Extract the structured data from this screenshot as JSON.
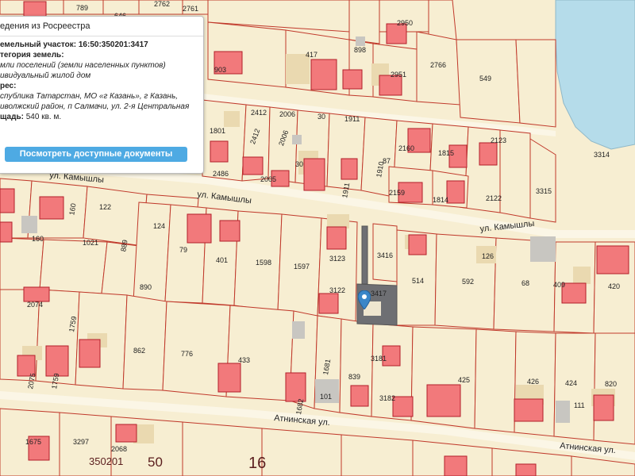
{
  "info_panel": {
    "title": "едения из Росреестра",
    "cadastral_label": "емельный участок:",
    "cadastral_number": "16:50:350201:3417",
    "category_label": "тегория земель:",
    "category_value": "мли поселений (земли населенных пунктов)",
    "usage_value": "ивидуальный жилой дом",
    "address_label": "рес:",
    "address_line1": "спублика Татарстан, МО «г Казань», г Казань,",
    "address_line2": "иволжский район, п Салмачи, ул. 2-я Центральная",
    "area_label": "щадь:",
    "area_value": "540 кв. м.",
    "docs_button": "Посмотреть доступные документы"
  },
  "streets": [
    "ул. Камышлы",
    "ул. Камышлы",
    "ул. Камышлы",
    "Атнинская ул.",
    "Атнинская ул."
  ],
  "block_labels": [
    "350201",
    "50",
    "16"
  ],
  "plot_numbers": {
    "p789": "789",
    "p646": "646",
    "p2762": "2762",
    "p2761": "2761",
    "p2950": "2950",
    "p417": "417",
    "p898": "898",
    "p903": "903",
    "p2951": "2951",
    "p2766": "2766",
    "p549": "549",
    "p2412a": "2412",
    "p2006a": "2006",
    "p30a": "30",
    "p1911a": "1911",
    "p1801": "1801",
    "p2412b": "2412",
    "p2006b": "2006",
    "p2160": "2160",
    "p1815": "1815",
    "p2123": "2123",
    "p2486": "2486",
    "p2005": "2005",
    "p30b": "30",
    "p87": "87",
    "p3314": "3314",
    "p1911b": "1911",
    "p1910": "1910",
    "p2159": "2159",
    "p1814": "1814",
    "p2122": "2122",
    "p3315": "3315",
    "p122": "122",
    "p160a": "160",
    "p124": "124",
    "p160b": "160",
    "p1021": "1021",
    "p889": "889",
    "p79": "79",
    "p401": "401",
    "p1598": "1598",
    "p1597": "1597",
    "p3123": "3123",
    "p3416": "3416",
    "p126": "126",
    "p514": "514",
    "p592": "592",
    "p68": "68",
    "p409": "409",
    "p420": "420",
    "p890": "890",
    "p3122": "3122",
    "p3417": "3417",
    "p2074": "2074",
    "p1759": "1759",
    "p862": "862",
    "p776": "776",
    "p433": "433",
    "p3181": "3181",
    "p1681": "1681",
    "p839": "839",
    "p425": "425",
    "p426": "426",
    "p424": "424",
    "p820": "820",
    "p2075": "2075",
    "p101": "101",
    "p1682": "1682",
    "p3182": "3182",
    "p111": "111",
    "p1675": "1675",
    "p3297": "3297",
    "p2068": "2068"
  }
}
